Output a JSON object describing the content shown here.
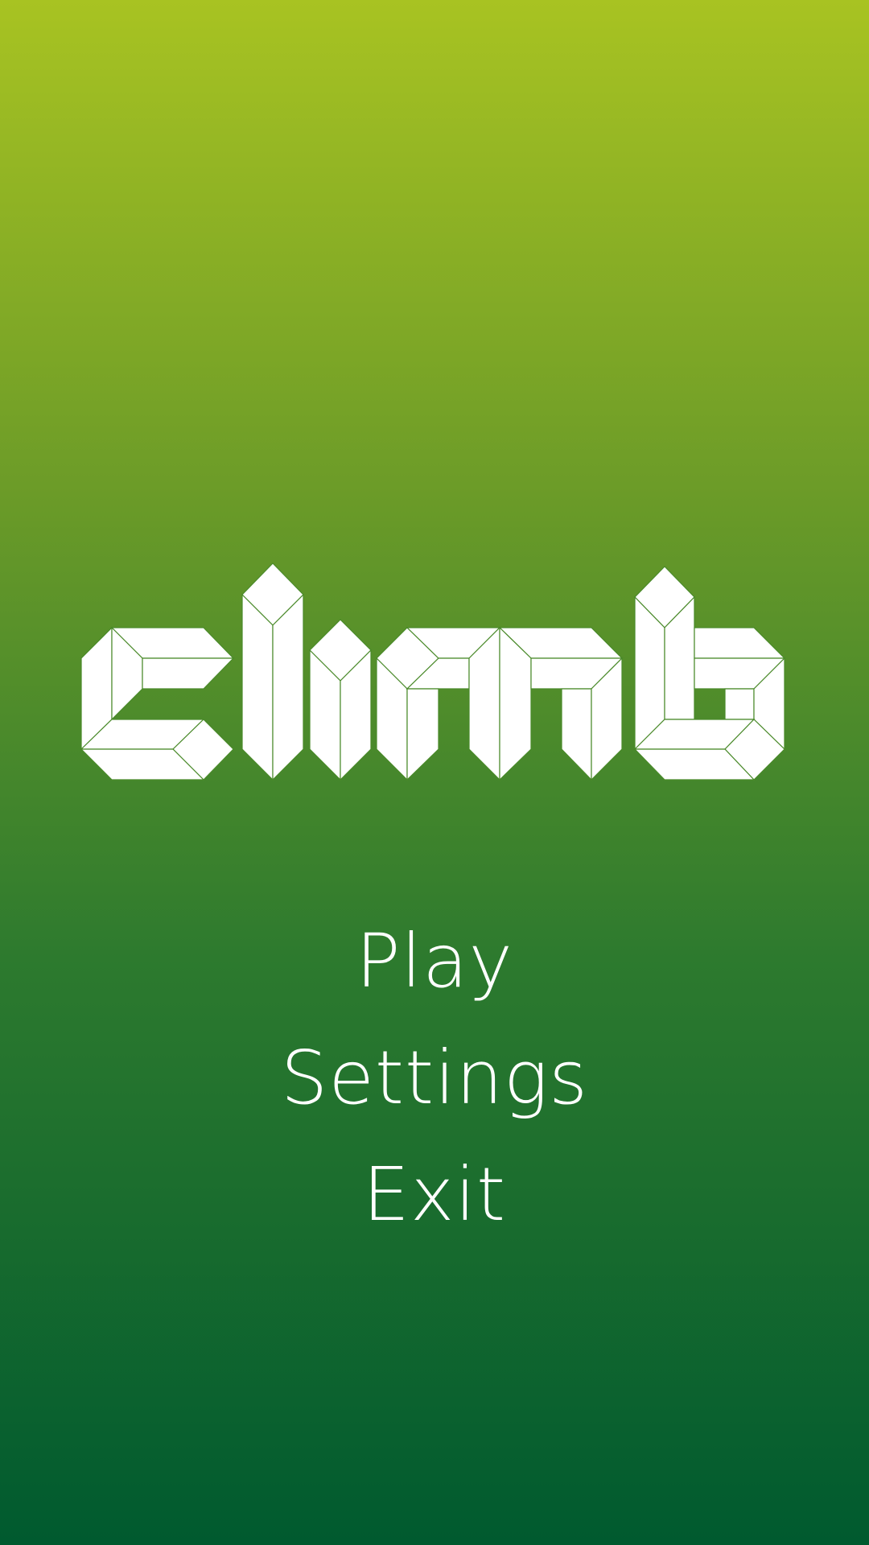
{
  "background": {
    "top_color": "#a8c322",
    "bottom_color": "#005a2f"
  },
  "logo": {
    "text": "climb",
    "fill_color": "#ffffff",
    "outline_color": "#4a8a2a"
  },
  "menu": {
    "items": [
      {
        "label": "Play"
      },
      {
        "label": "Settings"
      },
      {
        "label": "Exit"
      }
    ]
  }
}
